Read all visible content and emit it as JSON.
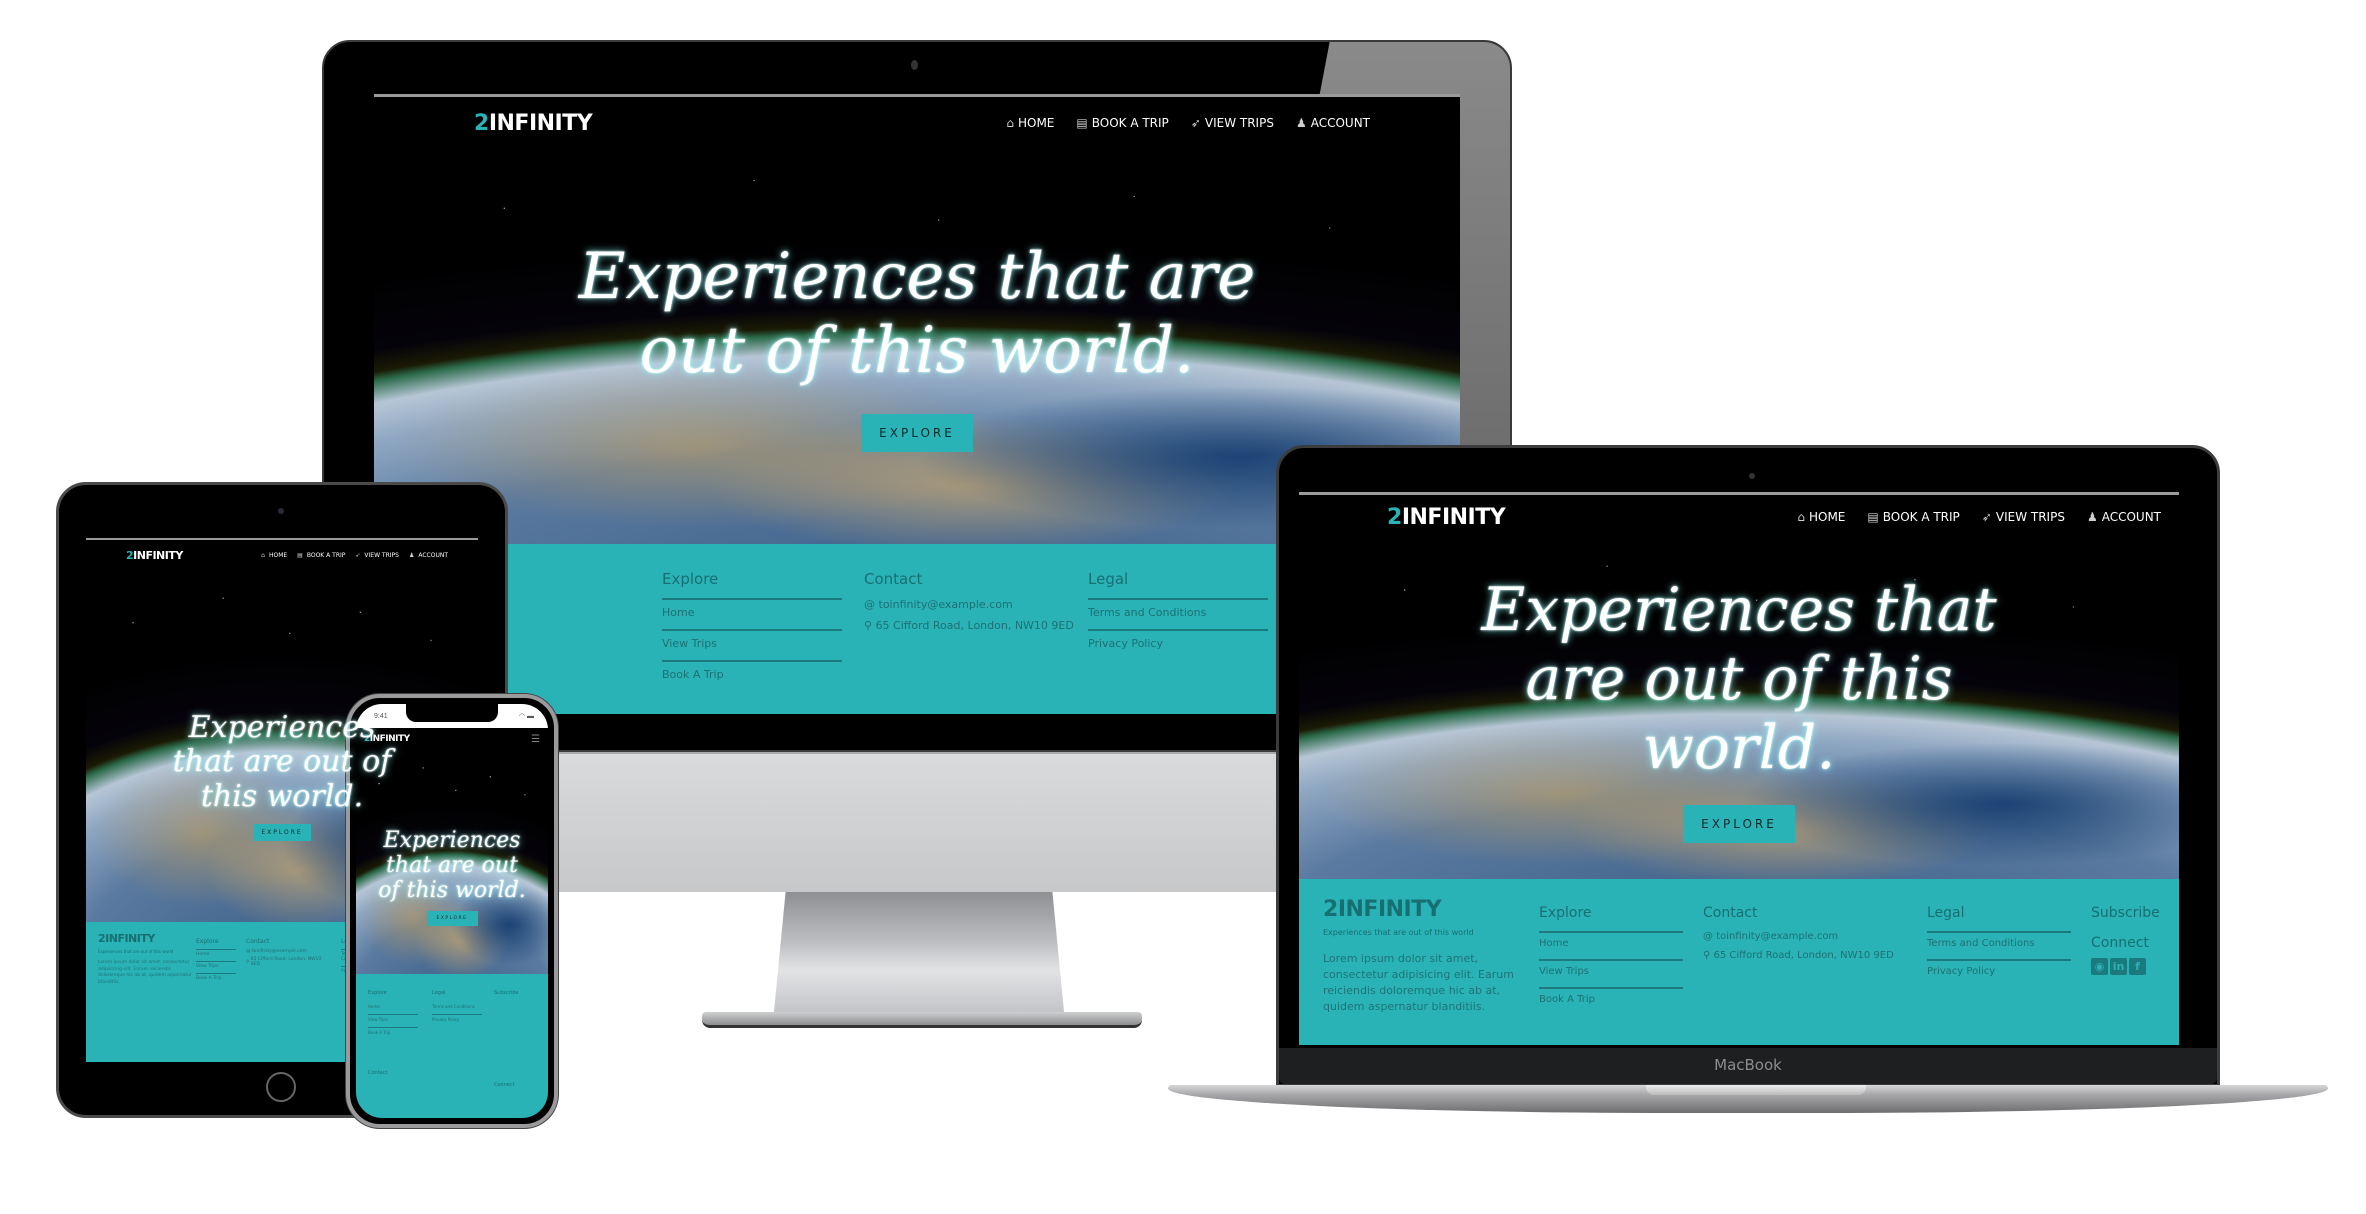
{
  "site": {
    "logo_prefix": "2",
    "logo_text": "INFINITY",
    "accent_color": "#2ab3b6",
    "nav": [
      {
        "label": "HOME",
        "icon": "home-icon",
        "glyph": "⌂"
      },
      {
        "label": "BOOK A TRIP",
        "icon": "calendar-icon",
        "glyph": "▤"
      },
      {
        "label": "VIEW TRIPS",
        "icon": "rocket-icon",
        "glyph": "➶"
      },
      {
        "label": "ACCOUNT",
        "icon": "user-icon",
        "glyph": "♟"
      }
    ],
    "menu_glyph": "☰",
    "hero_title": "Experiences that are out of this world.",
    "explore_label": "EXPLORE",
    "footer": {
      "tagline": "Experiences that are out of this world",
      "lorem": "Lorem ipsum dolor sit amet, consectetur adipisicing elit. Earum reiciendis doloremque hic ab at, quidem aspernatur blanditiis.",
      "explore_heading": "Explore",
      "explore_links": [
        "Home",
        "View Trips",
        "Book A Trip"
      ],
      "contact_heading": "Contact",
      "email_glyph": "@",
      "email": "toinfinity@example.com",
      "pin_glyph": "⚲",
      "address": "65 Cifford Road, London, NW10 9ED",
      "legal_heading": "Legal",
      "legal_links": [
        "Terms and Conditions",
        "Privacy Policy"
      ],
      "subscribe_heading": "Subscribe",
      "connect_heading": "Connect",
      "social": [
        {
          "name": "github",
          "glyph": "◉"
        },
        {
          "name": "linkedin",
          "glyph": "in"
        },
        {
          "name": "facebook",
          "glyph": "f"
        }
      ]
    }
  },
  "devices": {
    "macbook_label": "MacBook",
    "apple_glyph": "",
    "phone_time": "9:41",
    "phone_status_glyphs": "◠ ▬"
  }
}
